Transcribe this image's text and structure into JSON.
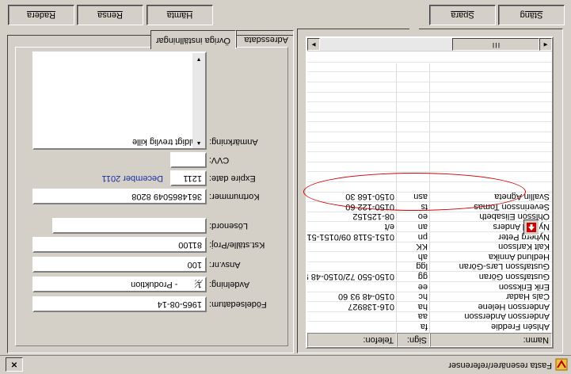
{
  "window": {
    "title": "Fasta resenärer/referenser",
    "close_symbol": "×"
  },
  "list": {
    "columns": [
      {
        "label": "Namn:"
      },
      {
        "label": "Sign:"
      },
      {
        "label": "Telefon:"
      }
    ],
    "rows": [
      {
        "name": "Ahlsén Freddie",
        "sign": "fa",
        "phone": ""
      },
      {
        "name": "Andersson Andersson",
        "sign": "aa",
        "phone": ""
      },
      {
        "name": "Andersson Helene",
        "sign": "ha",
        "phone": "016-138927"
      },
      {
        "name": "Cals Hadar",
        "sign": "hc",
        "phone": "0150-48 93 60"
      },
      {
        "name": "Erik Eriksson",
        "sign": "ee",
        "phone": ""
      },
      {
        "name": "Gustafsson Göran",
        "sign": "gg",
        "phone": "0150-550 72/0150-48 9"
      },
      {
        "name": "Gustafsson Lars-Göran",
        "sign": "lgg",
        "phone": ""
      },
      {
        "name": "Hedlund Annika",
        "sign": "ah",
        "phone": ""
      },
      {
        "name": "Kalt Karlsson",
        "sign": "KK",
        "phone": ""
      },
      {
        "name": "Nyberg Peter",
        "sign": "pn",
        "phone": "0151-5118 09/0151-51"
      },
      {
        "name": "Nylund Anders",
        "sign": "an",
        "phone": "e/t"
      },
      {
        "name": "Ohlsson Elisabeth",
        "sign": "eo",
        "phone": "08-125152"
      },
      {
        "name": "Severinsson Tomas",
        "sign": "ts",
        "phone": "0150-122 60"
      },
      {
        "name": "Svallin Agneta",
        "sign": "asn",
        "phone": "0150-168 30"
      }
    ],
    "scroll_thumb": "III",
    "scroll_left": "◄",
    "scroll_right": "►"
  },
  "tabs": [
    {
      "label": "Adressdata",
      "active": false
    },
    {
      "label": "Övriga inställningar",
      "active": true
    }
  ],
  "form": {
    "birthdate": {
      "label": "Födelsedatum:",
      "value": "1965-08-14"
    },
    "department": {
      "label": "Avdelning:",
      "value": "1        - Produktion"
    },
    "ansvar": {
      "label": "Ansv.nr:",
      "value": "100"
    },
    "kostnadsstalle": {
      "label": "Kst.ställe/Proj:",
      "value": "81100"
    },
    "password": {
      "label": "Lösenord:",
      "value": ""
    },
    "card_number": {
      "label": "Kortnummer:",
      "value": "3614865049 8208"
    },
    "expire": {
      "label": "Expire date:",
      "value": "1211",
      "month_text": "December 2011"
    },
    "cvv": {
      "label": "CVV:",
      "value": ""
    },
    "remark": {
      "label": "Anmärkning:",
      "value": "Väldigt trevlig kille"
    }
  },
  "buttons": {
    "radera": "Radera",
    "rensa": "Rensa",
    "hamta": "Hämta",
    "spara": "Spara",
    "stang": "Stäng"
  },
  "colors": {
    "highlight_ellipse": "#cc0000",
    "month_text": "#1a2ea0"
  }
}
